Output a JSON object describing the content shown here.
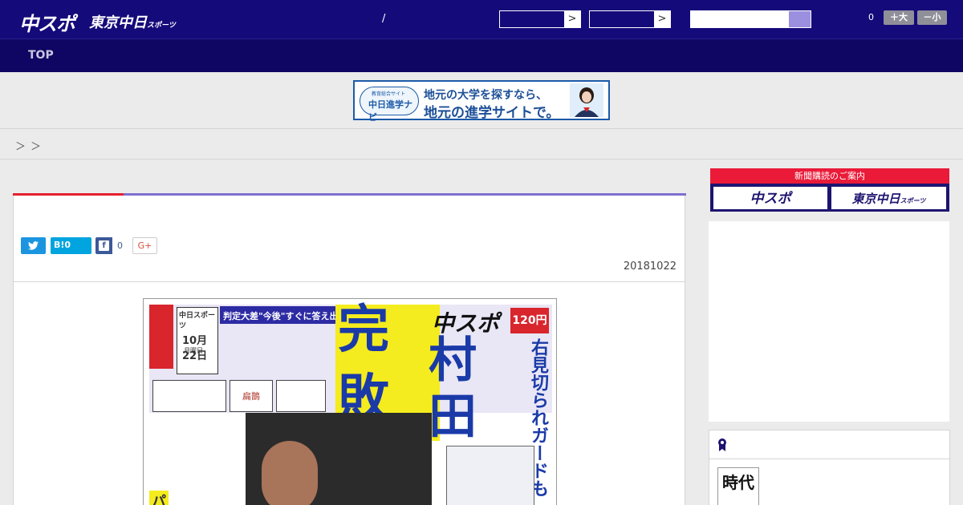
{
  "header": {
    "logo_chuspo": "中スポ",
    "logo_tokyo": "東京中日",
    "logo_tokyo_suffix": "スポーツ",
    "separator": "/",
    "select_1_arrow": ">",
    "select_2_arrow": ">",
    "search_placeholder": "",
    "count": "0",
    "font_up": "＋大",
    "font_down": "－小"
  },
  "nav": {
    "top": "TOP"
  },
  "ad": {
    "logo_small": "教育総合サイト",
    "logo_main": "中日進学ナビ",
    "line1": "地元の大学を探すなら、",
    "line2": "地元の進学サイトで。"
  },
  "breadcrumb": [
    "＞",
    "＞"
  ],
  "article": {
    "share_hatena": "B!0",
    "share_facebook_icon": "f",
    "share_facebook_count": "0",
    "share_gplus": "G+",
    "date": "20181022"
  },
  "newspaper": {
    "mast_logo": "中日スポーツ",
    "mast_date": "10月22日",
    "mast_day": "月曜日",
    "headline_bar": "判定大差\"今後\"すぐに答え出ない",
    "logo_big": "中スポ",
    "price": "120円",
    "kan": "完",
    "hai": "敗",
    "mura": "村",
    "ta": "田",
    "vertical": "右見切られガードも",
    "ad2": "扁鵲",
    "pa": "パ"
  },
  "sidebar": {
    "subscription_title": "新聞購読のご案内",
    "sub_chuspo": "中スポ",
    "sub_tokyo": "東京中日",
    "sub_tokyo_suffix": "スポーツ",
    "rank_thumb": "時代"
  },
  "colors": {
    "header_bg": "#150a7a",
    "nav_bg": "#0f0663",
    "accent_red": "#e6202d",
    "accent_purple": "#7f6fd0",
    "twitter": "#1b95e0",
    "hatena": "#00a4de",
    "facebook": "#3b5998"
  }
}
